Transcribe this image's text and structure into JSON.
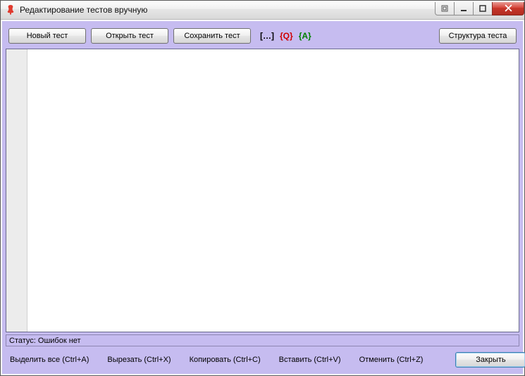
{
  "window": {
    "title": "Редактирование тестов вручную"
  },
  "toolbar": {
    "new_test": "Новый тест",
    "open_test": "Открыть тест",
    "save_test": "Сохранить тест",
    "structure": "Структура теста",
    "token_ellipsis": "[…]",
    "token_q": "{Q}",
    "token_a": "{A}"
  },
  "editor": {
    "content": ""
  },
  "status": {
    "label": "Статус: Ошибок нет"
  },
  "bottom": {
    "select_all": "Выделить все (Ctrl+A)",
    "cut": "Вырезать (Ctrl+X)",
    "copy": "Копировать (Ctrl+C)",
    "paste": "Вставить (Ctrl+V)",
    "undo": "Отменить (Ctrl+Z)",
    "close": "Закрыть"
  }
}
